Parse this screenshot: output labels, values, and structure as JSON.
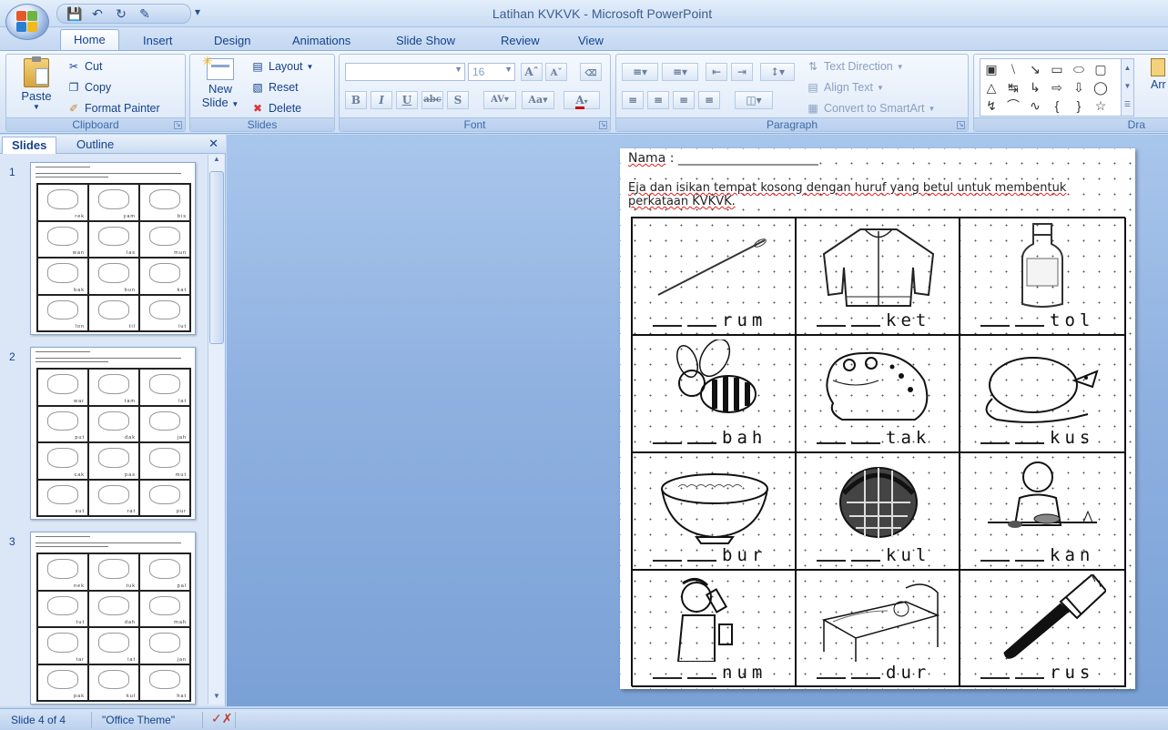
{
  "window": {
    "title": "Latihan KVKVK - Microsoft PowerPoint"
  },
  "ribbon_tabs": [
    "Home",
    "Insert",
    "Design",
    "Animations",
    "Slide Show",
    "Review",
    "View"
  ],
  "clipboard": {
    "paste": "Paste",
    "cut": "Cut",
    "copy": "Copy",
    "format_painter": "Format Painter",
    "label": "Clipboard"
  },
  "slides_group": {
    "new_slide_1": "New",
    "new_slide_2": "Slide",
    "layout": "Layout",
    "reset": "Reset",
    "delete": "Delete",
    "label": "Slides"
  },
  "font_group": {
    "font_name": "",
    "font_size": "16",
    "label": "Font"
  },
  "paragraph_group": {
    "text_direction": "Text Direction",
    "align_text": "Align Text",
    "convert_smartart": "Convert to SmartArt",
    "label": "Paragraph"
  },
  "drawing_group": {
    "arrange": "Arr",
    "label": "Dra"
  },
  "pane_tabs": {
    "slides": "Slides",
    "outline": "Outline"
  },
  "thumbnails": [
    {
      "num": "1",
      "words": [
        "rek",
        "yam",
        "bis",
        "wan",
        "las",
        "mun",
        "bak",
        "bun",
        "kat",
        "lon",
        "til",
        "lut"
      ]
    },
    {
      "num": "2",
      "words": [
        "war",
        "tam",
        "lat",
        "put",
        "dak",
        "jah",
        "cak",
        "pas",
        "mut",
        "sut",
        "rat",
        "pur"
      ]
    },
    {
      "num": "3",
      "words": [
        "nek",
        "tuk",
        "pal",
        "tut",
        "dah",
        "mah",
        "tar",
        "lat",
        "jan",
        "pak",
        "kul",
        "hat"
      ]
    }
  ],
  "slide": {
    "nama_label": "Nama",
    "nama_rest": " : ______________________",
    "instruction": "Eja dan isikan tempat kosong dengan huruf yang betul untuk membentuk perkataan KVKVK.",
    "cells": [
      {
        "word": "rum",
        "icon": "needle-icon"
      },
      {
        "word": "ket",
        "icon": "jacket-icon"
      },
      {
        "word": "tol",
        "icon": "bottle-icon"
      },
      {
        "word": "bah",
        "icon": "bee-icon"
      },
      {
        "word": "tak",
        "icon": "frog-icon"
      },
      {
        "word": "kus",
        "icon": "rat-icon"
      },
      {
        "word": "bur",
        "icon": "porridge-bowl-icon"
      },
      {
        "word": "kul",
        "icon": "basket-icon"
      },
      {
        "word": "kan",
        "icon": "girl-eating-icon"
      },
      {
        "word": "num",
        "icon": "boy-drinking-icon"
      },
      {
        "word": "dur",
        "icon": "sleeping-bed-icon"
      },
      {
        "word": "rus",
        "icon": "paintbrush-icon"
      }
    ]
  },
  "status": {
    "slide_position": "Slide 4 of 4",
    "theme": "\"Office Theme\""
  }
}
